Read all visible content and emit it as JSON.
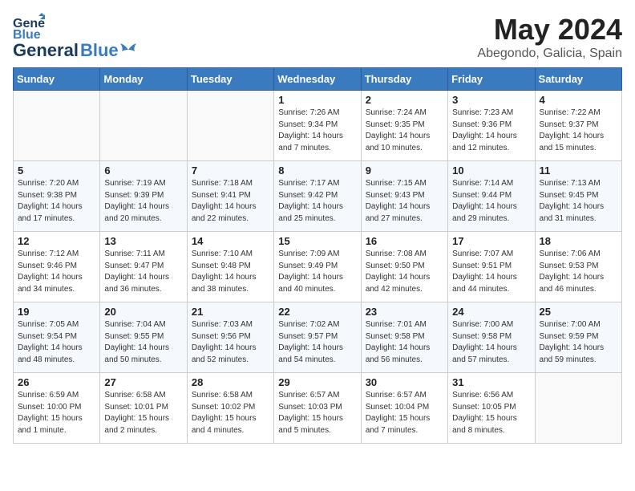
{
  "header": {
    "logo_line1": "General",
    "logo_line2": "Blue",
    "month": "May 2024",
    "location": "Abegondo, Galicia, Spain"
  },
  "weekdays": [
    "Sunday",
    "Monday",
    "Tuesday",
    "Wednesday",
    "Thursday",
    "Friday",
    "Saturday"
  ],
  "weeks": [
    [
      {
        "day": "",
        "info": ""
      },
      {
        "day": "",
        "info": ""
      },
      {
        "day": "",
        "info": ""
      },
      {
        "day": "1",
        "info": "Sunrise: 7:26 AM\nSunset: 9:34 PM\nDaylight: 14 hours\nand 7 minutes."
      },
      {
        "day": "2",
        "info": "Sunrise: 7:24 AM\nSunset: 9:35 PM\nDaylight: 14 hours\nand 10 minutes."
      },
      {
        "day": "3",
        "info": "Sunrise: 7:23 AM\nSunset: 9:36 PM\nDaylight: 14 hours\nand 12 minutes."
      },
      {
        "day": "4",
        "info": "Sunrise: 7:22 AM\nSunset: 9:37 PM\nDaylight: 14 hours\nand 15 minutes."
      }
    ],
    [
      {
        "day": "5",
        "info": "Sunrise: 7:20 AM\nSunset: 9:38 PM\nDaylight: 14 hours\nand 17 minutes."
      },
      {
        "day": "6",
        "info": "Sunrise: 7:19 AM\nSunset: 9:39 PM\nDaylight: 14 hours\nand 20 minutes."
      },
      {
        "day": "7",
        "info": "Sunrise: 7:18 AM\nSunset: 9:41 PM\nDaylight: 14 hours\nand 22 minutes."
      },
      {
        "day": "8",
        "info": "Sunrise: 7:17 AM\nSunset: 9:42 PM\nDaylight: 14 hours\nand 25 minutes."
      },
      {
        "day": "9",
        "info": "Sunrise: 7:15 AM\nSunset: 9:43 PM\nDaylight: 14 hours\nand 27 minutes."
      },
      {
        "day": "10",
        "info": "Sunrise: 7:14 AM\nSunset: 9:44 PM\nDaylight: 14 hours\nand 29 minutes."
      },
      {
        "day": "11",
        "info": "Sunrise: 7:13 AM\nSunset: 9:45 PM\nDaylight: 14 hours\nand 31 minutes."
      }
    ],
    [
      {
        "day": "12",
        "info": "Sunrise: 7:12 AM\nSunset: 9:46 PM\nDaylight: 14 hours\nand 34 minutes."
      },
      {
        "day": "13",
        "info": "Sunrise: 7:11 AM\nSunset: 9:47 PM\nDaylight: 14 hours\nand 36 minutes."
      },
      {
        "day": "14",
        "info": "Sunrise: 7:10 AM\nSunset: 9:48 PM\nDaylight: 14 hours\nand 38 minutes."
      },
      {
        "day": "15",
        "info": "Sunrise: 7:09 AM\nSunset: 9:49 PM\nDaylight: 14 hours\nand 40 minutes."
      },
      {
        "day": "16",
        "info": "Sunrise: 7:08 AM\nSunset: 9:50 PM\nDaylight: 14 hours\nand 42 minutes."
      },
      {
        "day": "17",
        "info": "Sunrise: 7:07 AM\nSunset: 9:51 PM\nDaylight: 14 hours\nand 44 minutes."
      },
      {
        "day": "18",
        "info": "Sunrise: 7:06 AM\nSunset: 9:53 PM\nDaylight: 14 hours\nand 46 minutes."
      }
    ],
    [
      {
        "day": "19",
        "info": "Sunrise: 7:05 AM\nSunset: 9:54 PM\nDaylight: 14 hours\nand 48 minutes."
      },
      {
        "day": "20",
        "info": "Sunrise: 7:04 AM\nSunset: 9:55 PM\nDaylight: 14 hours\nand 50 minutes."
      },
      {
        "day": "21",
        "info": "Sunrise: 7:03 AM\nSunset: 9:56 PM\nDaylight: 14 hours\nand 52 minutes."
      },
      {
        "day": "22",
        "info": "Sunrise: 7:02 AM\nSunset: 9:57 PM\nDaylight: 14 hours\nand 54 minutes."
      },
      {
        "day": "23",
        "info": "Sunrise: 7:01 AM\nSunset: 9:58 PM\nDaylight: 14 hours\nand 56 minutes."
      },
      {
        "day": "24",
        "info": "Sunrise: 7:00 AM\nSunset: 9:58 PM\nDaylight: 14 hours\nand 57 minutes."
      },
      {
        "day": "25",
        "info": "Sunrise: 7:00 AM\nSunset: 9:59 PM\nDaylight: 14 hours\nand 59 minutes."
      }
    ],
    [
      {
        "day": "26",
        "info": "Sunrise: 6:59 AM\nSunset: 10:00 PM\nDaylight: 15 hours\nand 1 minute."
      },
      {
        "day": "27",
        "info": "Sunrise: 6:58 AM\nSunset: 10:01 PM\nDaylight: 15 hours\nand 2 minutes."
      },
      {
        "day": "28",
        "info": "Sunrise: 6:58 AM\nSunset: 10:02 PM\nDaylight: 15 hours\nand 4 minutes."
      },
      {
        "day": "29",
        "info": "Sunrise: 6:57 AM\nSunset: 10:03 PM\nDaylight: 15 hours\nand 5 minutes."
      },
      {
        "day": "30",
        "info": "Sunrise: 6:57 AM\nSunset: 10:04 PM\nDaylight: 15 hours\nand 7 minutes."
      },
      {
        "day": "31",
        "info": "Sunrise: 6:56 AM\nSunset: 10:05 PM\nDaylight: 15 hours\nand 8 minutes."
      },
      {
        "day": "",
        "info": ""
      }
    ]
  ]
}
